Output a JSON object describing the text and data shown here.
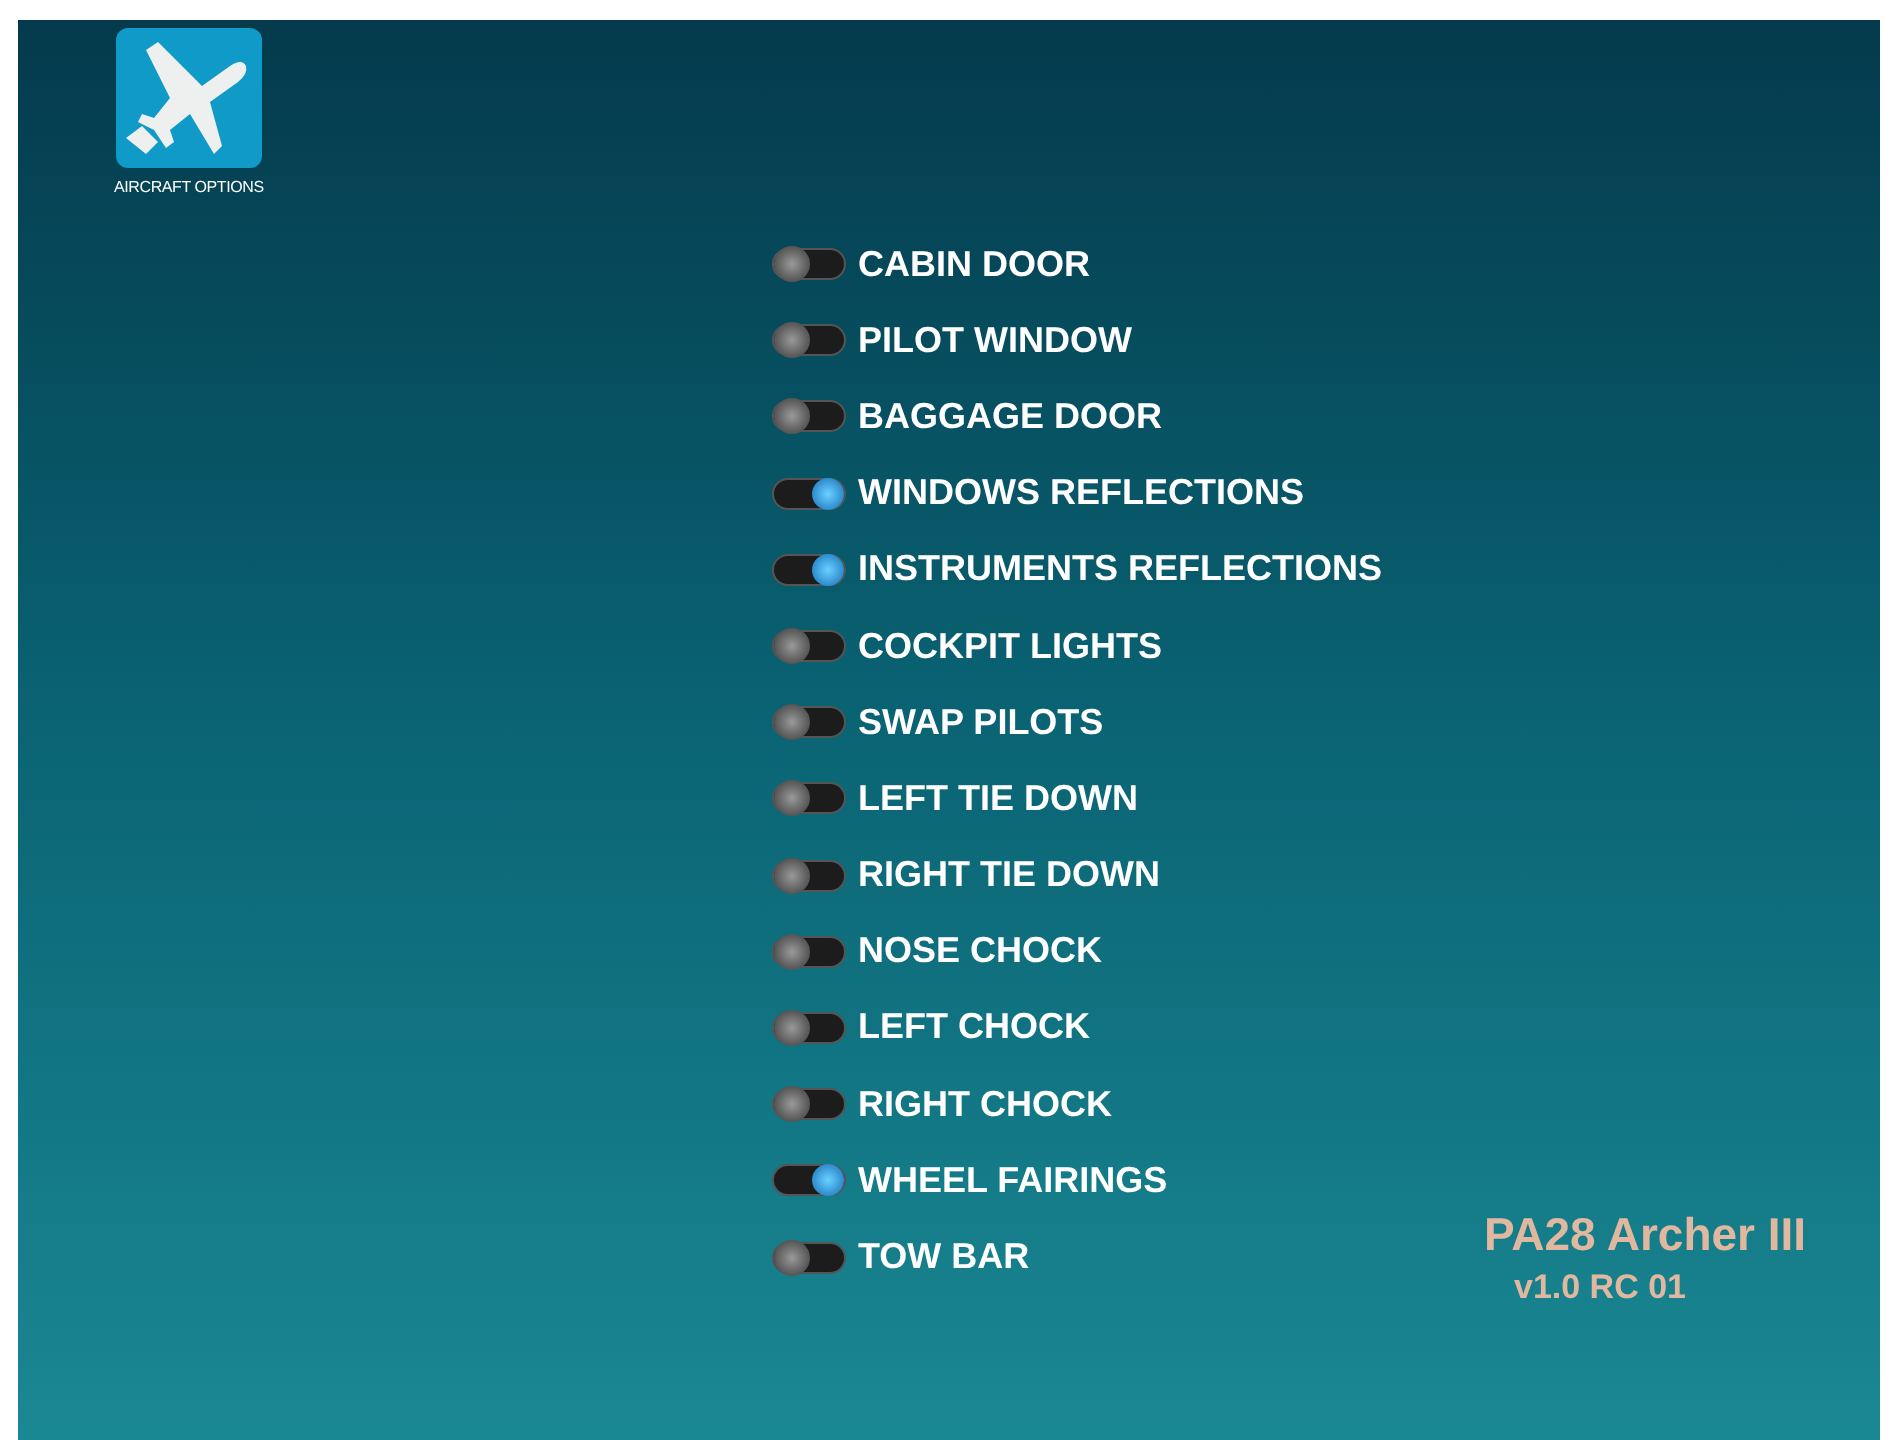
{
  "app_icon": {
    "label": "AIRCRAFT OPTIONS"
  },
  "options": [
    {
      "label": "CABIN DOOR",
      "on": false
    },
    {
      "label": "PILOT WINDOW",
      "on": false
    },
    {
      "label": "BAGGAGE DOOR",
      "on": false
    },
    {
      "label": "WINDOWS REFLECTIONS",
      "on": true
    },
    {
      "label": "INSTRUMENTS REFLECTIONS",
      "on": true
    },
    {
      "label": "COCKPIT LIGHTS",
      "on": false
    },
    {
      "label": "SWAP PILOTS",
      "on": false
    },
    {
      "label": "LEFT TIE DOWN",
      "on": false
    },
    {
      "label": "RIGHT TIE DOWN",
      "on": false
    },
    {
      "label": "NOSE CHOCK",
      "on": false
    },
    {
      "label": "LEFT CHOCK",
      "on": false
    },
    {
      "label": "RIGHT CHOCK",
      "on": false
    },
    {
      "label": "WHEEL FAIRINGS",
      "on": true
    },
    {
      "label": "TOW BAR",
      "on": false
    }
  ],
  "product": {
    "name": "PA28 Archer III",
    "version": "v1.0 RC 01"
  }
}
